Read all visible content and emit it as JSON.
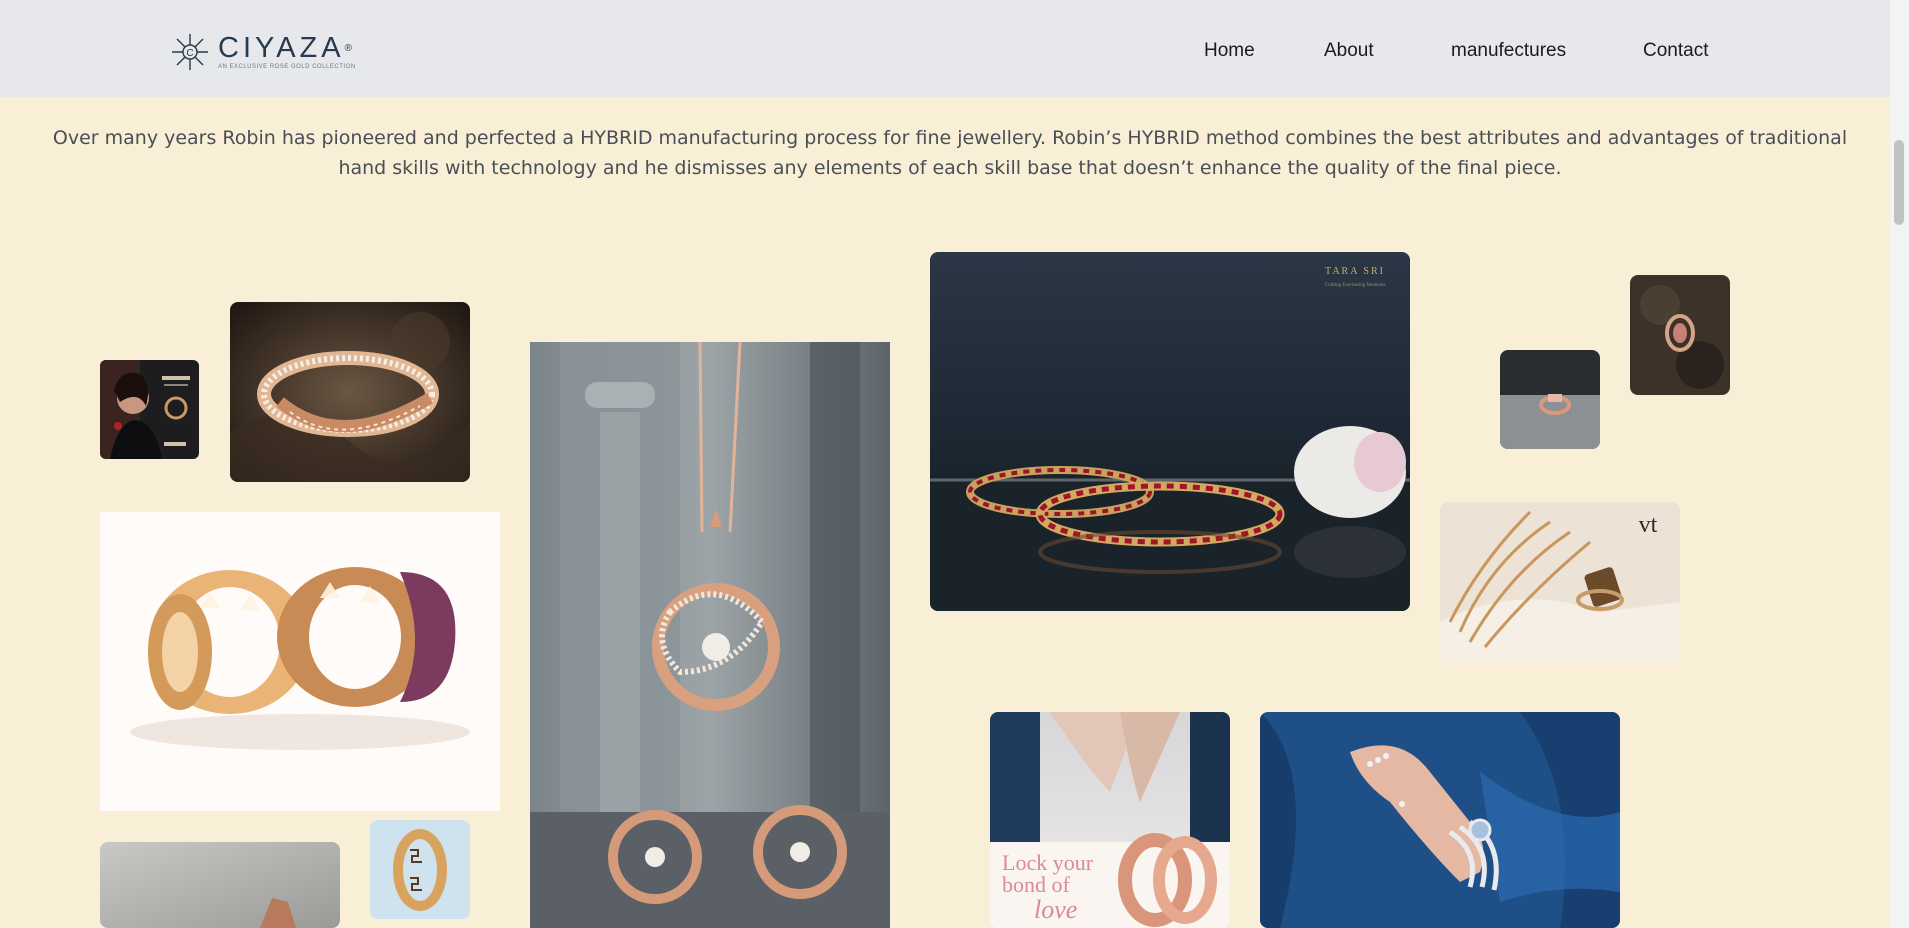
{
  "brand": {
    "name": "CIYAZA",
    "mark": "®",
    "tagline": "AN EXCLUSIVE ROSE GOLD COLLECTION"
  },
  "nav": {
    "home": "Home",
    "about": "About",
    "manufactures": "manufectures",
    "contact": "Contact"
  },
  "intro": "Over many years Robin has pioneered and perfected a HYBRID manufacturing process for fine jewellery. Robin’s HYBRID method combines the best attributes and advantages of traditional hand skills with technology and he dismisses any elements of each skill base that doesn’t enhance the quality of the final piece.",
  "gallery": {
    "tara_sri_brand": "TARA SRI",
    "tara_sri_sub": "Crafting Everlasting Moments",
    "vt_logo": "vt",
    "poster_line1": "Lock your",
    "poster_line2": "bond of",
    "poster_line3": "love"
  },
  "colors": {
    "page_bg": "#f9eed6",
    "header_bg": "#e6e8eb",
    "brand_navy": "#273a4f",
    "rose_gold": "#d9966e"
  }
}
